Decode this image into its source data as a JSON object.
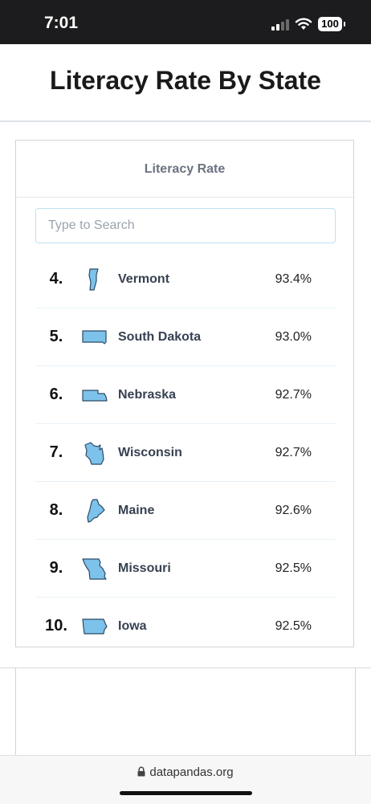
{
  "status_bar": {
    "time": "7:01",
    "battery": "100"
  },
  "page": {
    "title": "Literacy Rate By State"
  },
  "card": {
    "header": "Literacy Rate",
    "search_placeholder": "Type to Search",
    "rows": [
      {
        "rank": "4.",
        "state": "Vermont",
        "rate": "93.4%",
        "icon": "vermont-map-icon"
      },
      {
        "rank": "5.",
        "state": "South Dakota",
        "rate": "93.0%",
        "icon": "south-dakota-map-icon"
      },
      {
        "rank": "6.",
        "state": "Nebraska",
        "rate": "92.7%",
        "icon": "nebraska-map-icon"
      },
      {
        "rank": "7.",
        "state": "Wisconsin",
        "rate": "92.7%",
        "icon": "wisconsin-map-icon"
      },
      {
        "rank": "8.",
        "state": "Maine",
        "rate": "92.6%",
        "icon": "maine-map-icon"
      },
      {
        "rank": "9.",
        "state": "Missouri",
        "rate": "92.5%",
        "icon": "missouri-map-icon"
      },
      {
        "rank": "10.",
        "state": "Iowa",
        "rate": "92.5%",
        "icon": "iowa-map-icon"
      }
    ]
  },
  "browser": {
    "url": "datapandas.org"
  },
  "colors": {
    "map_fill": "#7cc2ea",
    "map_stroke": "#2c4a66",
    "statusbar_bg": "#1c1c1e"
  }
}
